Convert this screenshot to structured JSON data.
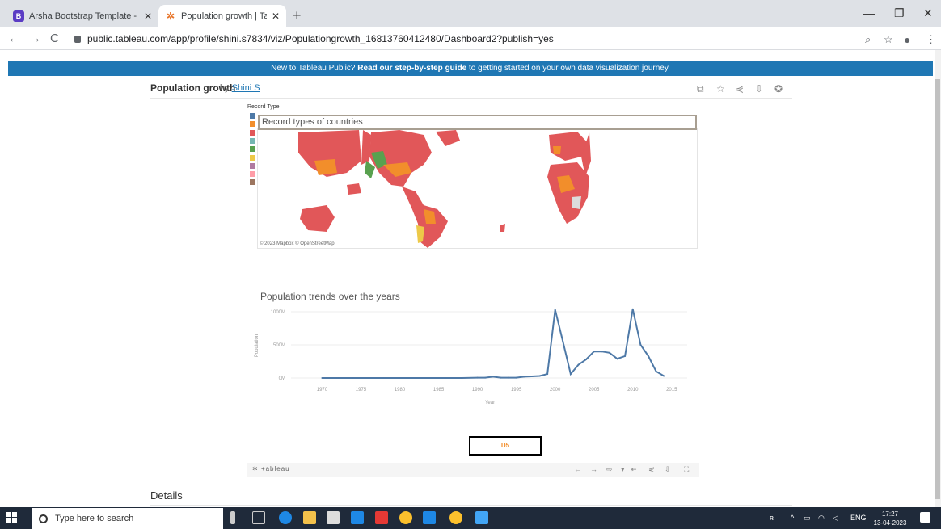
{
  "browser": {
    "tabs": [
      {
        "title": "Arsha Bootstrap Template - Index",
        "favicon": "B"
      },
      {
        "title": "Population growth | Tableau Public",
        "favicon": "tableau-icon"
      }
    ],
    "new_tab": "+",
    "url": "public.tableau.com/app/profile/shini.s7834/viz/Populationgrowth_16813760412480/Dashboard2?publish=yes"
  },
  "banner": {
    "prefix": "New to Tableau Public?",
    "bold": "Read our step-by-step guide",
    "suffix": "to getting started on your own data visualization journey."
  },
  "viz": {
    "title": "Population growth",
    "by": "by",
    "author": "Shini S"
  },
  "map": {
    "legend_title": "Record Type",
    "legend_colors": [
      "#4e79a7",
      "#f28e2b",
      "#e15759",
      "#76b7b2",
      "#59a14f",
      "#edc948",
      "#b07aa1",
      "#ff9da7",
      "#9c755f"
    ],
    "tooltip_text": "Record types of countries",
    "attribution": "© 2023 Mapbox © OpenStreetMap"
  },
  "chart_data": {
    "type": "line",
    "title": "Population trends over the years",
    "xlabel": "Year",
    "ylabel": "Population",
    "x_ticks": [
      "1970",
      "1975",
      "1980",
      "1985",
      "1990",
      "1995",
      "2000",
      "2005",
      "2010",
      "2015"
    ],
    "y_ticks": [
      "1000M",
      "500M",
      "0M"
    ],
    "xlim": [
      1966,
      2017
    ],
    "ylim": [
      0,
      1000
    ],
    "color": "#4e79a7",
    "series": [
      {
        "x": [
          1970,
          1972,
          1974,
          1976,
          1978,
          1980,
          1982,
          1984,
          1986,
          1988,
          1990,
          1991,
          1992,
          1993,
          1994,
          1995,
          1996,
          1997,
          1998,
          1999,
          2000,
          2001,
          2002,
          2003,
          2004,
          2005,
          2006,
          2007,
          2008,
          2009,
          2010,
          2011,
          2012,
          2013,
          2014
        ],
        "values": [
          0,
          0,
          0,
          0,
          0,
          0,
          0,
          0,
          0,
          0,
          5,
          5,
          20,
          5,
          5,
          5,
          20,
          25,
          30,
          60,
          1030,
          550,
          60,
          200,
          280,
          400,
          400,
          380,
          290,
          330,
          1040,
          500,
          330,
          100,
          30
        ]
      }
    ]
  },
  "d5_label": "D5",
  "footer": {
    "logo": "+ableau",
    "details": "Details"
  },
  "taskbar": {
    "search_placeholder": "Type here to search",
    "lang": "ENG",
    "time": "17:27",
    "date": "13-04-2023"
  }
}
